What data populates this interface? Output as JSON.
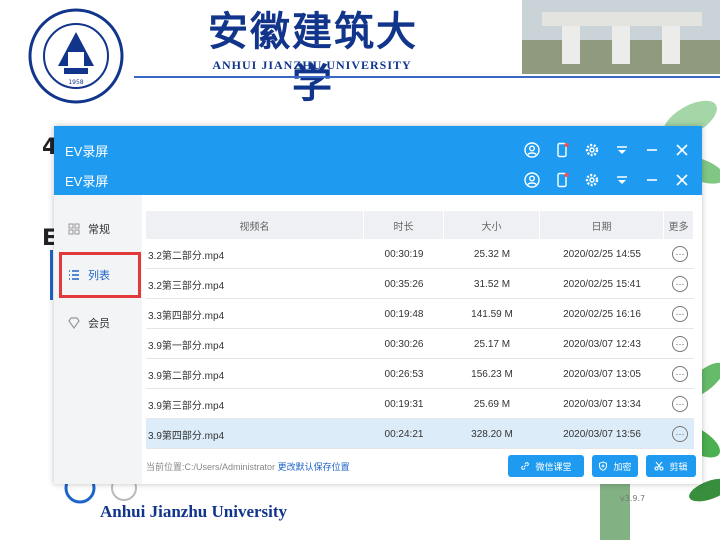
{
  "slide": {
    "university_cn": "安徽建筑大学",
    "university_en": "ANHUI JIANZHU UNIVERSITY",
    "footer_en": "Anhui Jianzhu University",
    "glyph_1": "4",
    "glyph_2": "E"
  },
  "app": {
    "title_1": "EV录屏",
    "title_2": "EV录屏",
    "version": "v3.9.7",
    "accent_color": "#1e9bf0",
    "highlight_color": "#e23a3a",
    "window_icons": [
      "user-icon",
      "phone-icon",
      "gear-icon",
      "dropdown-icon",
      "minimize-icon",
      "close-icon"
    ]
  },
  "sidebar": {
    "items": [
      {
        "label": "常规",
        "icon": "grid-icon"
      },
      {
        "label": "列表",
        "icon": "list-icon"
      },
      {
        "label": "会员",
        "icon": "diamond-icon"
      }
    ],
    "active_index": 1
  },
  "table": {
    "headers": {
      "name": "视频名",
      "duration": "时长",
      "size": "大小",
      "date": "日期",
      "more": "更多"
    },
    "rows": [
      {
        "name": "3.2第二部分.mp4",
        "duration": "00:30:19",
        "size": "25.32 M",
        "date": "2020/02/25 14:55",
        "more": "···"
      },
      {
        "name": "3.2第三部分.mp4",
        "duration": "00:35:26",
        "size": "31.52 M",
        "date": "2020/02/25 15:41",
        "more": "···"
      },
      {
        "name": "3.3第四部分.mp4",
        "duration": "00:19:48",
        "size": "141.59 M",
        "date": "2020/02/25 16:16",
        "more": "···"
      },
      {
        "name": "3.9第一部分.mp4",
        "duration": "00:30:26",
        "size": "25.17 M",
        "date": "2020/03/07 12:43",
        "more": "···"
      },
      {
        "name": "3.9第二部分.mp4",
        "duration": "00:26:53",
        "size": "156.23 M",
        "date": "2020/03/07 13:05",
        "more": "···"
      },
      {
        "name": "3.9第三部分.mp4",
        "duration": "00:19:31",
        "size": "25.69 M",
        "date": "2020/03/07 13:34",
        "more": "···"
      },
      {
        "name": "3.9第四部分.mp4",
        "duration": "00:24:21",
        "size": "328.20 M",
        "date": "2020/03/07 13:56",
        "more": "···"
      }
    ],
    "selected_index": 6
  },
  "bottom": {
    "path_label": "当前位置:",
    "path_value": "C:/Users/Administrator",
    "path_link": "更改默认保存位置",
    "buttons": [
      {
        "label": "微信课堂",
        "icon": "link-icon"
      },
      {
        "label": "加密",
        "icon": "shield-icon"
      },
      {
        "label": "剪辑",
        "icon": "scissors-icon"
      }
    ]
  }
}
